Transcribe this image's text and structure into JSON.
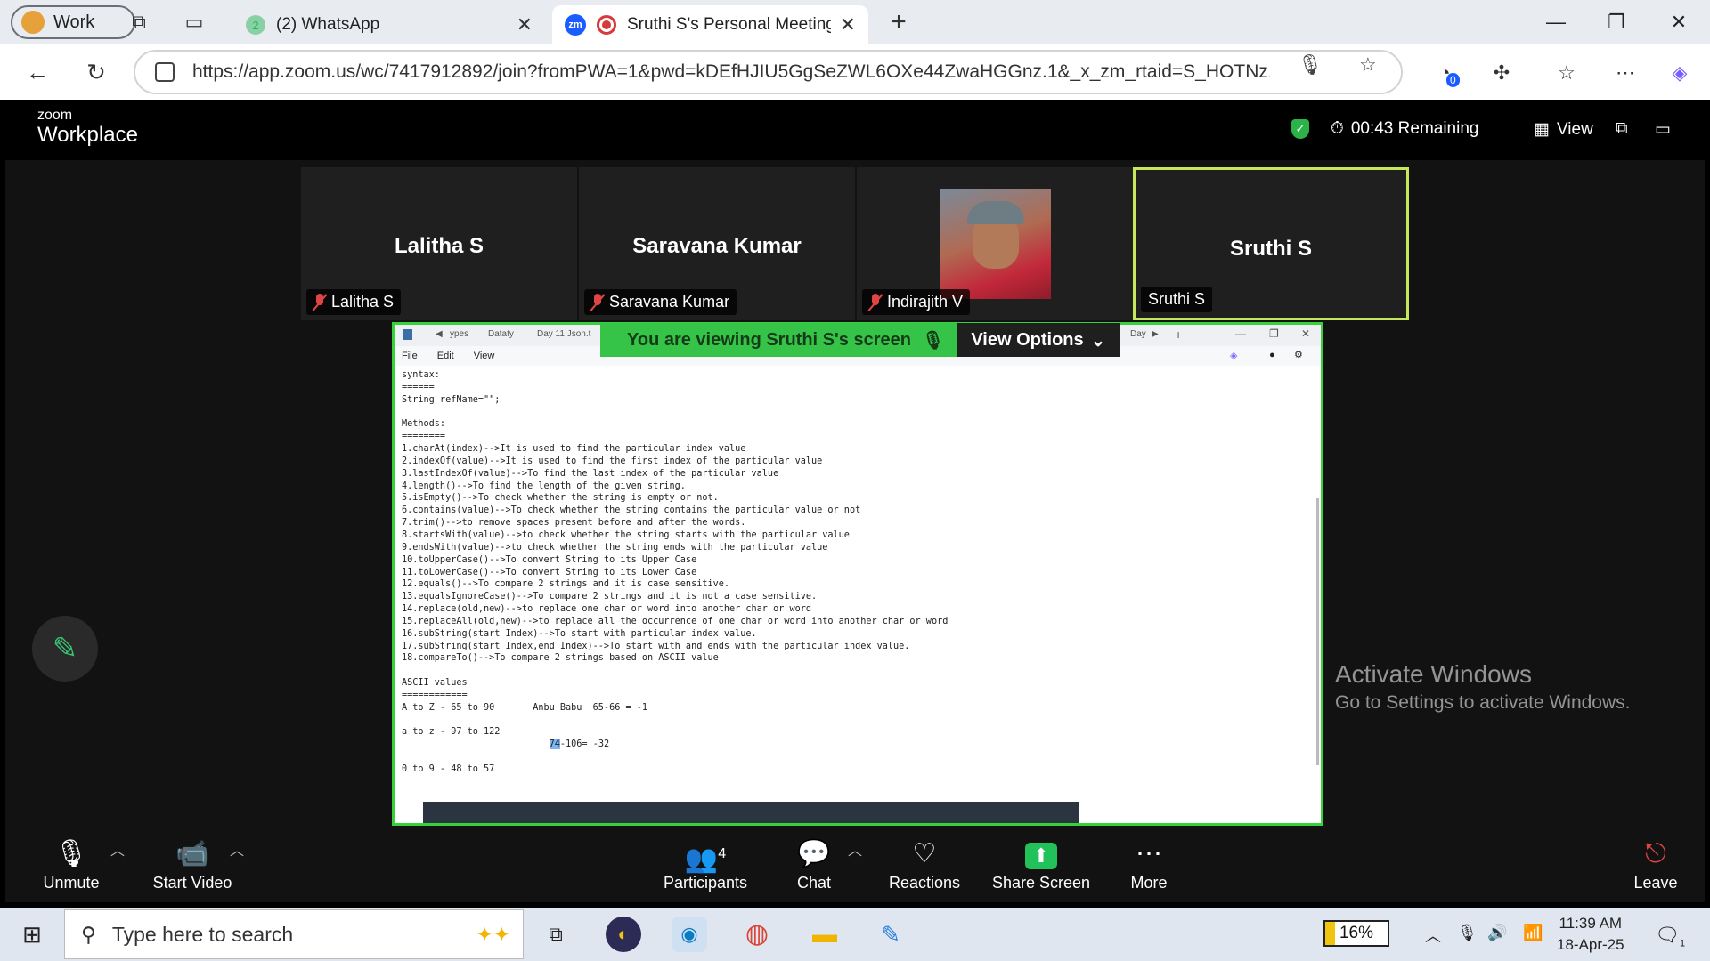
{
  "browser": {
    "profile_label": "Work",
    "tabs": [
      {
        "label": "(2) WhatsApp",
        "badge": "2"
      },
      {
        "label": "Sruthi S's Personal Meeting R",
        "favicon": "zm"
      }
    ],
    "url": "https://app.zoom.us/wc/7417912892/join?fromPWA=1&pwd=kDEfHJIU5GgSeZWL6OXe44ZwaHGGnz.1&_x_zm_rtaid=S_HOTNz...",
    "extension_badge": "0"
  },
  "zoom": {
    "logo_small": "zoom",
    "logo_big": "Workplace",
    "timer": "00:43 Remaining",
    "view_label": "View",
    "participants": [
      {
        "name": "Lalitha S",
        "tag": "Lalitha S",
        "muted": true
      },
      {
        "name": "Saravana Kumar",
        "tag": "Saravana Kumar",
        "muted": true
      },
      {
        "name": "",
        "tag": "Indirajith V",
        "muted": true,
        "has_photo": true
      },
      {
        "name": "Sruthi S",
        "tag": "Sruthi S",
        "muted": false
      }
    ],
    "viewing_banner": "You are viewing  Sruthi S's screen",
    "view_options": "View Options",
    "notepad": {
      "title_fragments": [
        "ypes",
        "Dataty",
        "Day 11 Json.t",
        "Day"
      ],
      "menu": [
        "File",
        "Edit",
        "View"
      ],
      "lines": [
        "syntax:",
        "======",
        "String refName=\"\";",
        "",
        "Methods:",
        "========",
        "1.charAt(index)-->It is used to find the particular index value",
        "2.indexOf(value)-->It is used to find the first index of the particular value",
        "3.lastIndexOf(value)-->To find the last index of the particular value",
        "4.length()-->To find the length of the given string.",
        "5.isEmpty()-->To check whether the string is empty or not.",
        "6.contains(value)-->To check whether the string contains the particular value or not",
        "7.trim()-->to remove spaces present before and after the words.",
        "8.startsWith(value)-->to check whether the string starts with the particular value",
        "9.endsWith(value)-->to check whether the string ends with the particular value",
        "10.toUpperCase()-->To convert String to its Upper Case",
        "11.toLowerCase()-->To convert String to its Lower Case",
        "12.equals()-->To compare 2 strings and it is case sensitive.",
        "13.equalsIgnoreCase()-->To compare 2 strings and it is not a case sensitive.",
        "14.replace(old,new)-->to replace one char or word into another char or word",
        "15.replaceAll(old,new)-->to replace all the occurrence of one char or word into another char or word",
        "16.subString(start Index)-->To start with particular index value.",
        "17.subString(start Index,end Index)-->To start with and ends with the particular index value.",
        "18.compareTo()-->To compare 2 strings based on ASCII value",
        "",
        "ASCII values",
        "============",
        "A to Z - 65 to 90       Anbu Babu  65-66 = -1",
        "",
        "a to z - 97 to 122"
      ],
      "highlight_prefix": "                           ",
      "highlight_text": "74",
      "highlight_rest": "-106= -32",
      "last_lines": [
        "",
        "0 to 9 - 48 to 57"
      ]
    },
    "activate": {
      "line1": "Activate Windows",
      "line2": "Go to Settings to activate Windows."
    },
    "controls": {
      "unmute": "Unmute",
      "start_video": "Start Video",
      "participants": "Participants",
      "participants_count": "4",
      "chat": "Chat",
      "reactions": "Reactions",
      "share_screen": "Share Screen",
      "more": "More",
      "leave": "Leave"
    }
  },
  "taskbar": {
    "search_placeholder": "Type here to search",
    "battery": "16%",
    "time": "11:39 AM",
    "date": "18-Apr-25",
    "notification_count": "1"
  }
}
